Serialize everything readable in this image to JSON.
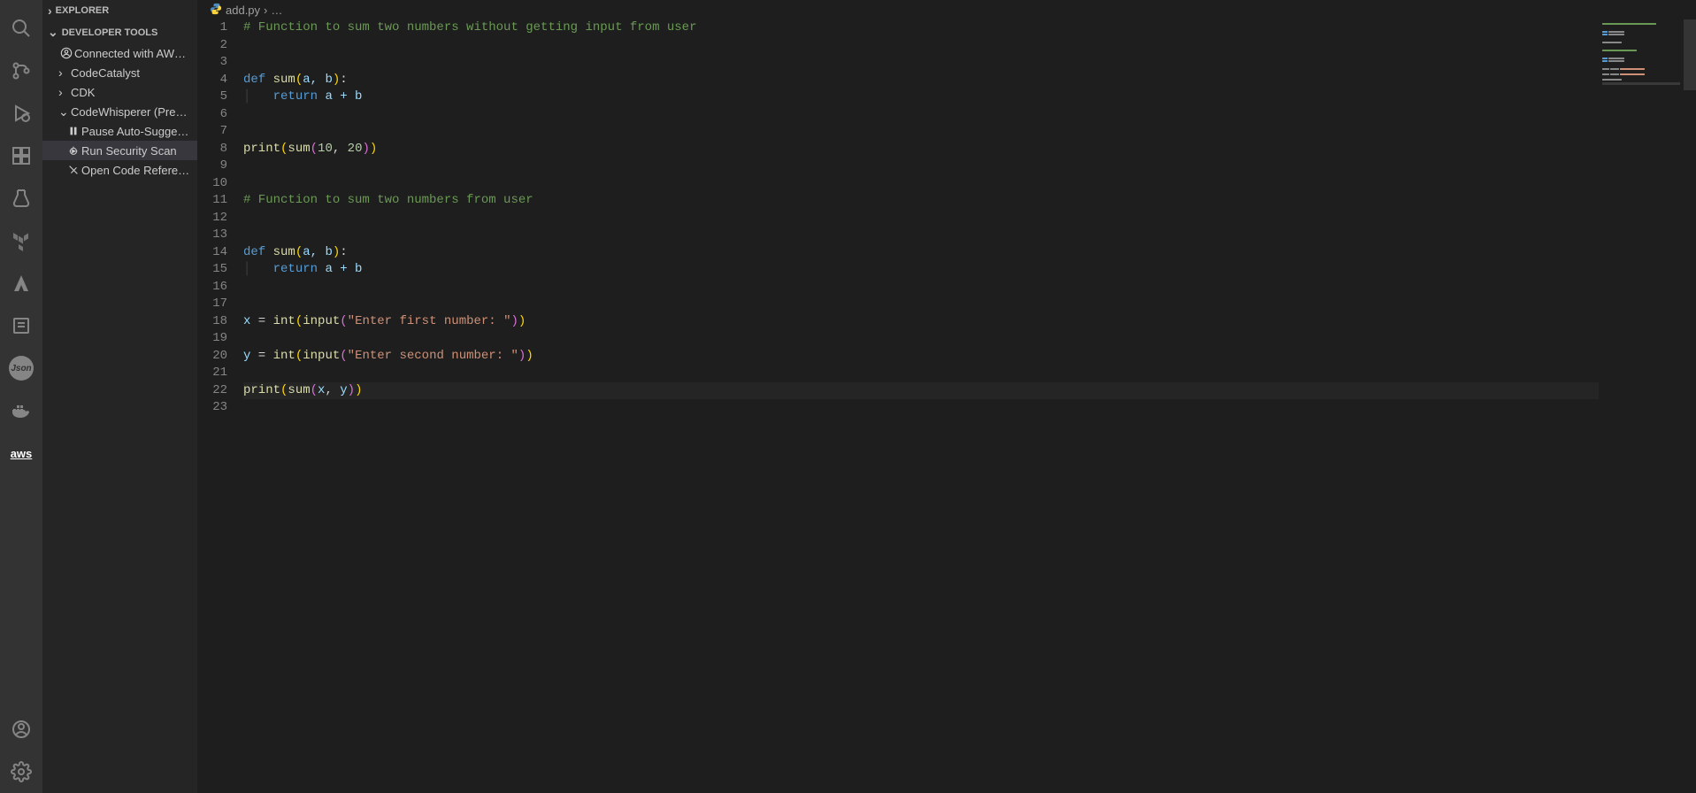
{
  "sidebar": {
    "explorer_label": "EXPLORER",
    "devtools_label": "DEVELOPER TOOLS",
    "items": [
      {
        "label": "Connected with AW…",
        "icon": "user-circle",
        "chev": ""
      },
      {
        "label": "CodeCatalyst",
        "icon": "",
        "chev": "›"
      },
      {
        "label": "CDK",
        "icon": "",
        "chev": "›"
      },
      {
        "label": "CodeWhisperer (Pre…",
        "icon": "",
        "chev": "⌄"
      }
    ],
    "cw_children": [
      {
        "label": "Pause Auto-Sugge…",
        "icon": "pause"
      },
      {
        "label": "Run Security Scan",
        "icon": "bug-run"
      },
      {
        "label": "Open Code Refere…",
        "icon": "dismiss"
      }
    ]
  },
  "breadcrumb": {
    "file": "add.py",
    "sep": "›",
    "more": "…"
  },
  "code": {
    "lines": [
      {
        "n": 1,
        "t": "comment",
        "text": "# Function to sum two numbers without getting input from user"
      },
      {
        "n": 2,
        "t": "blank",
        "text": ""
      },
      {
        "n": 3,
        "t": "blank",
        "text": ""
      },
      {
        "n": 4,
        "t": "def",
        "name": "sum",
        "params": "a, b"
      },
      {
        "n": 5,
        "t": "return",
        "expr": "a + b"
      },
      {
        "n": 6,
        "t": "blank",
        "text": ""
      },
      {
        "n": 7,
        "t": "blank",
        "text": ""
      },
      {
        "n": 8,
        "t": "print-nums",
        "func": "sum",
        "a": "10",
        "b": "20"
      },
      {
        "n": 9,
        "t": "blank",
        "text": ""
      },
      {
        "n": 10,
        "t": "blank",
        "text": ""
      },
      {
        "n": 11,
        "t": "comment",
        "text": "# Function to sum two numbers from user"
      },
      {
        "n": 12,
        "t": "blank",
        "text": ""
      },
      {
        "n": 13,
        "t": "blank",
        "text": ""
      },
      {
        "n": 14,
        "t": "def",
        "name": "sum",
        "params": "a, b"
      },
      {
        "n": 15,
        "t": "return",
        "expr": "a + b"
      },
      {
        "n": 16,
        "t": "blank",
        "text": ""
      },
      {
        "n": 17,
        "t": "blank",
        "text": ""
      },
      {
        "n": 18,
        "t": "input",
        "var": "x",
        "prompt": "Enter first number: "
      },
      {
        "n": 19,
        "t": "blank",
        "text": ""
      },
      {
        "n": 20,
        "t": "input",
        "var": "y",
        "prompt": "Enter second number: "
      },
      {
        "n": 21,
        "t": "blank",
        "text": ""
      },
      {
        "n": 22,
        "t": "print-vars",
        "func": "sum",
        "a": "x",
        "b": "y",
        "current": true
      },
      {
        "n": 23,
        "t": "blank",
        "text": ""
      }
    ]
  }
}
